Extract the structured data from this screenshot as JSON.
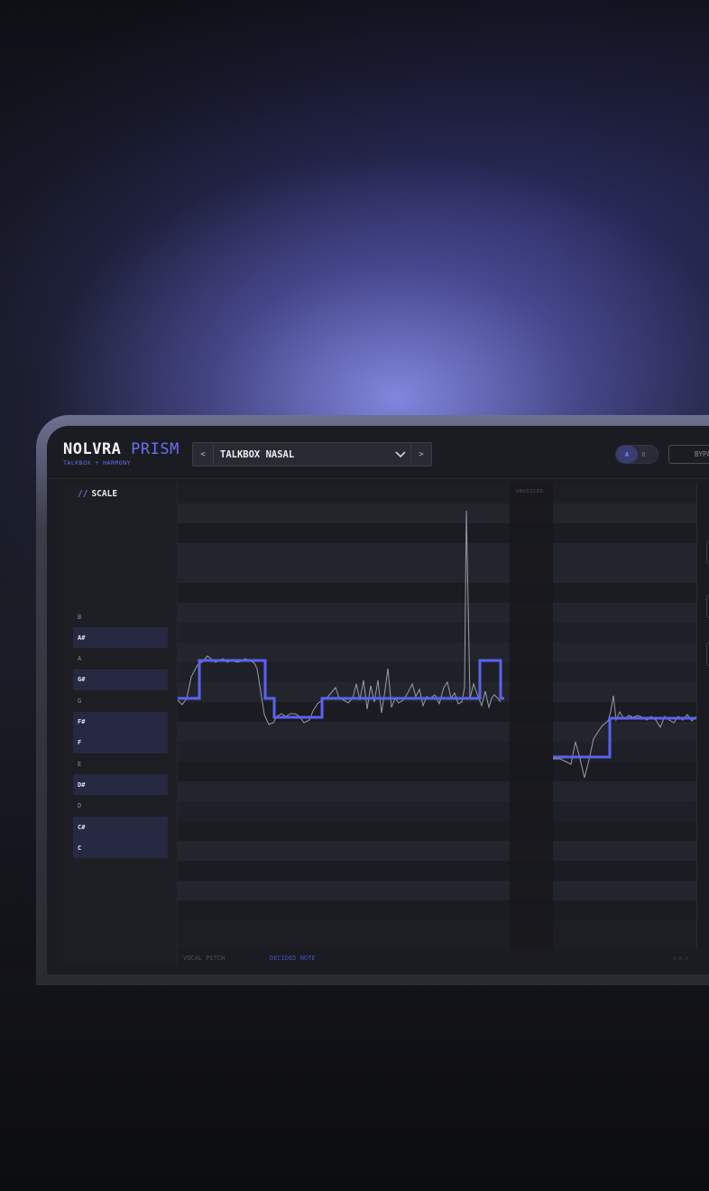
{
  "app": {
    "brand_primary": "NOLVRA",
    "brand_accent": "PRISM",
    "subtitle": "TALKBOX + HARMONY"
  },
  "header": {
    "preset_prev": "<",
    "preset_name": "TALKBOX NASAL",
    "preset_next": ">",
    "ab_a": "A",
    "ab_sep": "-",
    "ab_b": "B",
    "bypass_label": "BYPA"
  },
  "scale_panel": {
    "title_prefix": "//",
    "title": "SCALE",
    "notes": [
      {
        "label": "B",
        "in_scale": false
      },
      {
        "label": "A#",
        "in_scale": true
      },
      {
        "label": "A",
        "in_scale": false
      },
      {
        "label": "G#",
        "in_scale": true
      },
      {
        "label": "G",
        "in_scale": false
      },
      {
        "label": "F#",
        "in_scale": true
      },
      {
        "label": "F",
        "in_scale": true
      },
      {
        "label": "E",
        "in_scale": false
      },
      {
        "label": "D#",
        "in_scale": true
      },
      {
        "label": "D",
        "in_scale": false
      },
      {
        "label": "C#",
        "in_scale": true
      },
      {
        "label": "C",
        "in_scale": true
      }
    ]
  },
  "plot": {
    "unvoiced_label": "UNVOICED",
    "legend_vocal_pitch": "VOCAL PITCH",
    "legend_decided_note": "DECIDED NOTE",
    "version": "0.8.4"
  },
  "colors": {
    "accent": "#6a6ff0",
    "decided_note": "#5b62f0",
    "vocal_pitch": "#9a9ba6"
  }
}
